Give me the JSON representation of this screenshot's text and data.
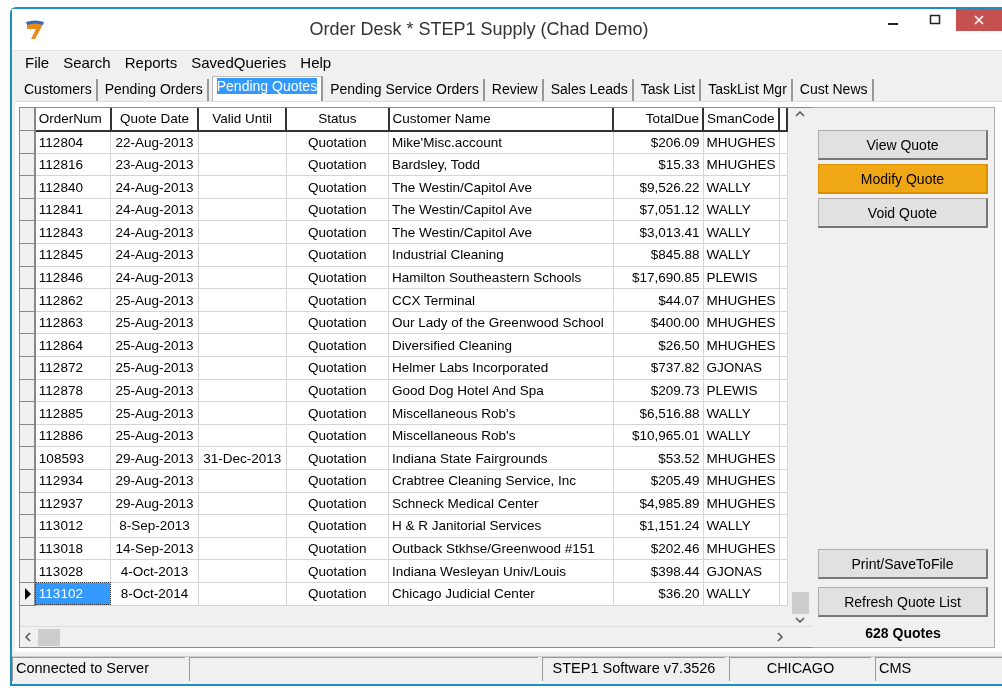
{
  "window": {
    "title": "Order Desk * STEP1 Supply (Chad Demo)"
  },
  "menu": [
    {
      "label": "File"
    },
    {
      "label": "Search"
    },
    {
      "label": "Reports"
    },
    {
      "label": "SavedQueries"
    },
    {
      "label": "Help"
    }
  ],
  "tabs": [
    {
      "label": "Customers",
      "selected": false
    },
    {
      "label": "Pending Orders",
      "selected": false
    },
    {
      "label": "Pending Quotes",
      "selected": true
    },
    {
      "label": "Pending Service Orders",
      "selected": false
    },
    {
      "label": "Review",
      "selected": false
    },
    {
      "label": "Sales Leads",
      "selected": false
    },
    {
      "label": "Task List",
      "selected": false
    },
    {
      "label": "TaskList Mgr",
      "selected": false
    },
    {
      "label": "Cust News",
      "selected": false
    }
  ],
  "table": {
    "columns": [
      "OrderNum",
      "Quote Date",
      "Valid Until",
      "Status",
      "Customer Name",
      "TotalDue",
      "SmanCode"
    ],
    "rows": [
      {
        "selected": false,
        "cells": [
          "112804",
          "22-Aug-2013",
          "",
          "Quotation",
          "Mike'Misc.account",
          "$206.09",
          "MHUGHES"
        ]
      },
      {
        "selected": false,
        "cells": [
          "112816",
          "23-Aug-2013",
          "",
          "Quotation",
          "Bardsley, Todd",
          "$15.33",
          "MHUGHES"
        ]
      },
      {
        "selected": false,
        "cells": [
          "112840",
          "24-Aug-2013",
          "",
          "Quotation",
          "The Westin/Capitol Ave",
          "$9,526.22",
          "WALLY"
        ]
      },
      {
        "selected": false,
        "cells": [
          "112841",
          "24-Aug-2013",
          "",
          "Quotation",
          "The Westin/Capitol Ave",
          "$7,051.12",
          "WALLY"
        ]
      },
      {
        "selected": false,
        "cells": [
          "112843",
          "24-Aug-2013",
          "",
          "Quotation",
          "The Westin/Capitol Ave",
          "$3,013.41",
          "WALLY"
        ]
      },
      {
        "selected": false,
        "cells": [
          "112845",
          "24-Aug-2013",
          "",
          "Quotation",
          "Industrial Cleaning",
          "$845.88",
          "WALLY"
        ]
      },
      {
        "selected": false,
        "cells": [
          "112846",
          "24-Aug-2013",
          "",
          "Quotation",
          "Hamilton Southeastern Schools",
          "$17,690.85",
          "PLEWIS"
        ]
      },
      {
        "selected": false,
        "cells": [
          "112862",
          "25-Aug-2013",
          "",
          "Quotation",
          "CCX Terminal",
          "$44.07",
          "MHUGHES"
        ]
      },
      {
        "selected": false,
        "cells": [
          "112863",
          "25-Aug-2013",
          "",
          "Quotation",
          "Our Lady of the Greenwood School",
          "$400.00",
          "MHUGHES"
        ]
      },
      {
        "selected": false,
        "cells": [
          "112864",
          "25-Aug-2013",
          "",
          "Quotation",
          "Diversified Cleaning",
          "$26.50",
          "MHUGHES"
        ]
      },
      {
        "selected": false,
        "cells": [
          "112872",
          "25-Aug-2013",
          "",
          "Quotation",
          "Helmer Labs Incorporated",
          "$737.82",
          "GJONAS"
        ]
      },
      {
        "selected": false,
        "cells": [
          "112878",
          "25-Aug-2013",
          "",
          "Quotation",
          "Good Dog Hotel And Spa",
          "$209.73",
          "PLEWIS"
        ]
      },
      {
        "selected": false,
        "cells": [
          "112885",
          "25-Aug-2013",
          "",
          "Quotation",
          "Miscellaneous Rob's",
          "$6,516.88",
          "WALLY"
        ]
      },
      {
        "selected": false,
        "cells": [
          "112886",
          "25-Aug-2013",
          "",
          "Quotation",
          "Miscellaneous Rob's",
          "$10,965.01",
          "WALLY"
        ]
      },
      {
        "selected": false,
        "cells": [
          "108593",
          "29-Aug-2013",
          "31-Dec-2013",
          "Quotation",
          "Indiana State Fairgrounds",
          "$53.52",
          "MHUGHES"
        ]
      },
      {
        "selected": false,
        "cells": [
          "112934",
          "29-Aug-2013",
          "",
          "Quotation",
          "Crabtree Cleaning Service, Inc",
          "$205.49",
          "MHUGHES"
        ]
      },
      {
        "selected": false,
        "cells": [
          "112937",
          "29-Aug-2013",
          "",
          "Quotation",
          "Schneck Medical Center",
          "$4,985.89",
          "MHUGHES"
        ]
      },
      {
        "selected": false,
        "cells": [
          "113012",
          "8-Sep-2013",
          "",
          "Quotation",
          "H & R  Janitorial  Services",
          "$1,151.24",
          "WALLY"
        ]
      },
      {
        "selected": false,
        "cells": [
          "113018",
          "14-Sep-2013",
          "",
          "Quotation",
          "Outback Stkhse/Greenwood #151",
          "$202.46",
          "MHUGHES"
        ]
      },
      {
        "selected": false,
        "cells": [
          "113028",
          "4-Oct-2013",
          "",
          "Quotation",
          "Indiana Wesleyan Univ/Louis",
          "$398.44",
          "GJONAS"
        ]
      },
      {
        "selected": true,
        "cells": [
          "113102",
          "8-Oct-2014",
          "",
          "Quotation",
          "Chicago Judicial Center",
          "$36.20",
          "WALLY"
        ]
      }
    ]
  },
  "actions": [
    {
      "label": "View Quote",
      "highlighted": false
    },
    {
      "label": "Modify Quote",
      "highlighted": true
    },
    {
      "label": "Void Quote",
      "highlighted": false
    }
  ],
  "lower_actions": [
    {
      "label": "Print/SaveToFile"
    },
    {
      "label": "Refresh Quote List"
    }
  ],
  "quote_count": "628 Quotes",
  "status_bar": [
    {
      "text": "Connected to Server"
    },
    {
      "text": "STEP1 Software v7.3526"
    },
    {
      "text": "CHICAGO"
    },
    {
      "text": "CMS"
    }
  ]
}
